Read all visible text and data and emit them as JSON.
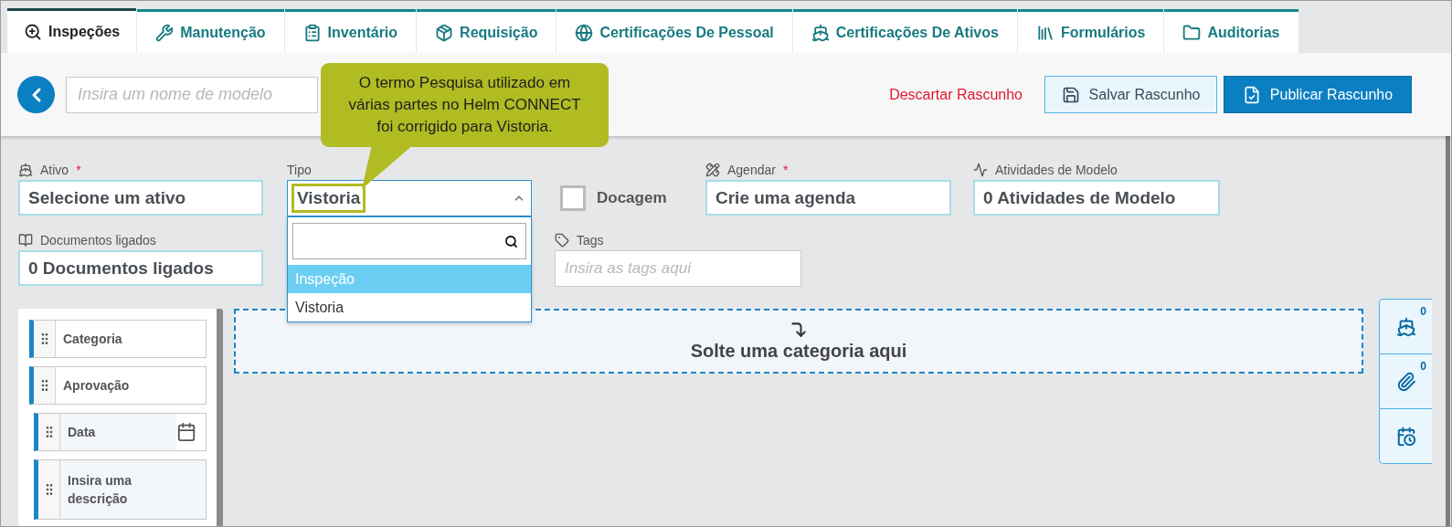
{
  "tabs": [
    {
      "label": "Inspeções",
      "selected": true
    },
    {
      "label": "Manutenção",
      "selected": false
    },
    {
      "label": "Inventário",
      "selected": false
    },
    {
      "label": "Requisição",
      "selected": false
    },
    {
      "label": "Certificações De Pessoal",
      "selected": false
    },
    {
      "label": "Certificações De Ativos",
      "selected": false
    },
    {
      "label": "Formulários",
      "selected": false
    },
    {
      "label": "Auditorias",
      "selected": false
    }
  ],
  "toolbar": {
    "template_name": {
      "placeholder": "Insira um nome de modelo"
    },
    "discard": "Descartar Rascunho",
    "save": "Salvar Rascunho",
    "publish": "Publicar Rascunho"
  },
  "callout": {
    "text": "O termo Pesquisa utilizado em várias partes no Helm CONNECT foi corrigido para Vistoria."
  },
  "form": {
    "asset": {
      "label": "Ativo",
      "required_mark": "*",
      "value": "Selecione um ativo"
    },
    "type": {
      "label": "Tipo",
      "value": "Vistoria",
      "expanded": true,
      "options": [
        {
          "label": "Inspeção",
          "highlighted": true
        },
        {
          "label": "Vistoria",
          "highlighted": false
        }
      ]
    },
    "docking": {
      "label": "Docagem",
      "checked": false
    },
    "schedule": {
      "label": "Agendar",
      "required_mark": "*",
      "value": "Crie uma agenda"
    },
    "activities": {
      "label": "Atividades de Modelo",
      "value": "0 Atividades de Modelo"
    },
    "documents": {
      "label": "Documentos ligados",
      "value": "0 Documentos ligados"
    },
    "tags": {
      "label": "Tags",
      "placeholder": "Insira as tags aqui"
    }
  },
  "palette": {
    "items": [
      {
        "label": "Categoria",
        "kind": "block"
      },
      {
        "label": "Aprovação",
        "kind": "block"
      },
      {
        "label": "Data",
        "kind": "date"
      },
      {
        "label": "Insira uma descrição",
        "kind": "text"
      }
    ]
  },
  "drop_zone": {
    "text": "Solte uma categoria aqui"
  },
  "side_panel": {
    "items": [
      {
        "kind": "asset",
        "count": "0"
      },
      {
        "kind": "attachment",
        "count": "0"
      },
      {
        "kind": "schedule"
      }
    ]
  }
}
